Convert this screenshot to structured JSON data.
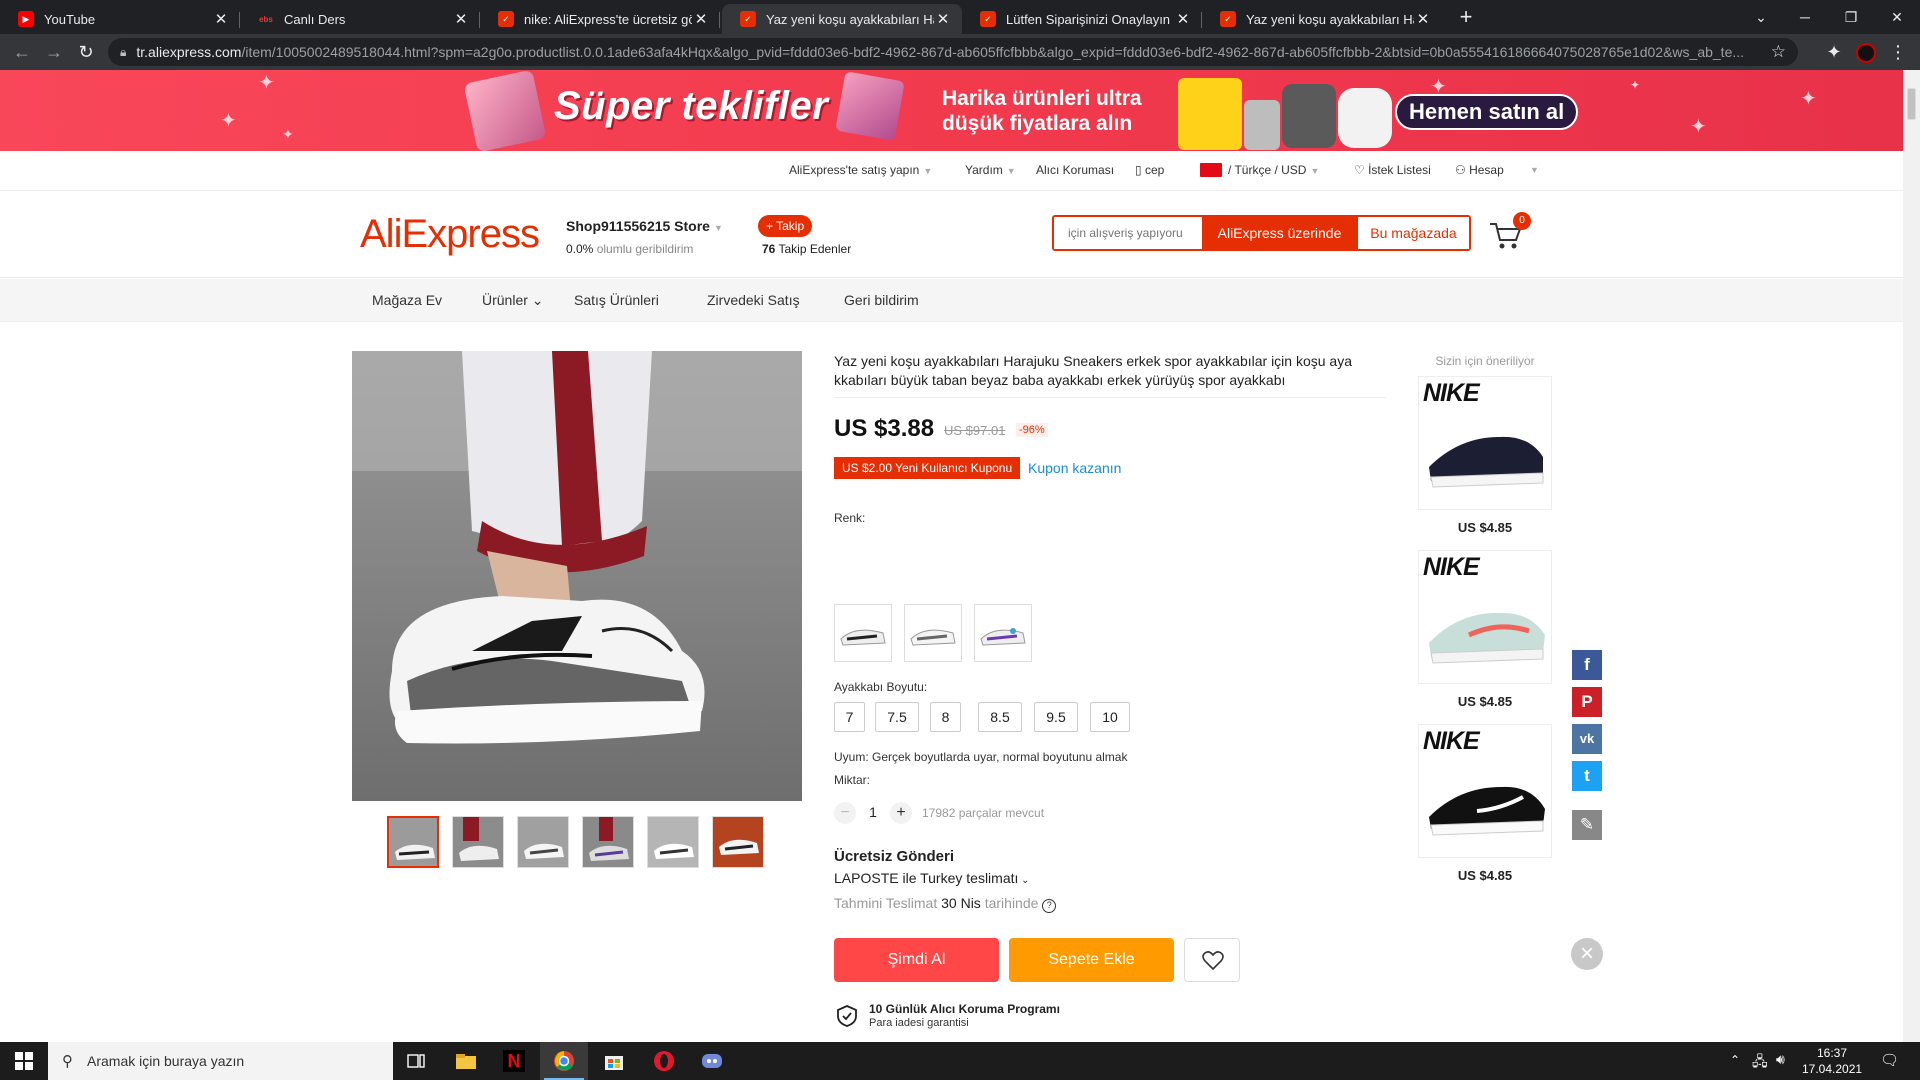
{
  "browser": {
    "tabs": [
      {
        "title": "YouTube",
        "favicon": "youtube-icon",
        "color": "#ff0000"
      },
      {
        "title": "Canlı Ders",
        "favicon": "ebs-icon",
        "color": "#e43a3a"
      },
      {
        "title": "nike: AliExpress'te ücretsiz gönde",
        "favicon": "aliexpress-icon",
        "color": "#e62e04"
      },
      {
        "title": "Yaz yeni koşu ayakkabıları Harajuk",
        "favicon": "aliexpress-icon",
        "color": "#e62e04",
        "active": true
      },
      {
        "title": "Lütfen Siparişinizi Onaylayın - Ali",
        "favicon": "aliexpress-icon",
        "color": "#e62e04"
      },
      {
        "title": "Yaz yeni koşu ayakkabıları Harajuk",
        "favicon": "aliexpress-icon",
        "color": "#e62e04"
      }
    ],
    "new_tab": "+",
    "url_host": "tr.aliexpress.com",
    "url_path": "/item/1005002489518044.html?spm=a2g0o.productlist.0.0.1ade63afa4kHqx&algo_pvid=fddd03e6-bdf2-4962-867d-ab605ffcfbbb&algo_expid=fddd03e6-bdf2-4962-867d-ab605ffcfbbb-2&btsid=0b0a555416186664075028765e1d02&ws_ab_te..."
  },
  "promo": {
    "title": "Süper teklifler",
    "line1": "Harika ürünleri ultra",
    "line2": "düşük fiyatlara alın",
    "cta": "Hemen satın al"
  },
  "util_bar": {
    "sell": "AliExpress'te satış yapın",
    "help": "Yardım",
    "buyer_protection": "Alıcı Koruması",
    "mobile": "cep",
    "language": "/ Türkçe / USD",
    "wishlist": "İstek Listesi",
    "account": "Hesap"
  },
  "store": {
    "logo": "AliExpress",
    "name": "Shop911556215 Store",
    "feedback_value": "0.0%",
    "feedback_text": "olumlu geribildirim",
    "follow": "+ Takip",
    "followers_count": "76",
    "followers_label": "Takip Edenler",
    "search_placeholder": "için alışveriş yapıyoru",
    "search_all": "AliExpress üzerinde",
    "search_store": "Bu mağazada",
    "cart_count": "0"
  },
  "store_nav": [
    "Mağaza Ev",
    "Ürünler",
    "Satış Ürünleri",
    "Zirvedeki Satış",
    "Geri bildirim"
  ],
  "product": {
    "title": "Yaz yeni koşu ayakkabıları Harajuku Sneakers erkek spor ayakkabılar için koşu aya kkabıları büyük taban beyaz baba ayakkabı erkek yürüyüş spor ayakkabı",
    "price": "US $3.88",
    "old_price": "US $97.01",
    "discount": "-96%",
    "coupon": "US $2.00 Yeni Kullanıcı Kuponu",
    "coupon_link": "Kupon kazanın",
    "color_label": "Renk:",
    "size_label": "Ayakkabı Boyutu:",
    "sizes": [
      "7",
      "7.5",
      "8",
      "8.5",
      "9.5",
      "10"
    ],
    "fit": "Uyum: Gerçek boyutlarda uyar, normal boyutunu almak",
    "qty_label": "Miktar:",
    "qty": "1",
    "qty_minus": "−",
    "qty_plus": "+",
    "available": "17982 parçalar mevcut",
    "shipping_title": "Ücretsiz Gönderi",
    "shipping_via": "LAPOSTE ile Turkey teslimatı",
    "delivery_prefix": "Tahmini Teslimat",
    "delivery_date": "30 Nis",
    "delivery_suffix": "tarihinde",
    "buy_now": "Şimdi Al",
    "add_to_cart": "Sepete Ekle",
    "protection_title": "10 Günlük Alıcı Koruma Programı",
    "protection_sub": "Para iadesi garantisi"
  },
  "recommend": {
    "title": "Sizin için öneriliyor",
    "brand": "NIKE",
    "items": [
      {
        "price": "US $4.85"
      },
      {
        "price": "US $4.85"
      },
      {
        "price": "US $4.85"
      }
    ]
  },
  "share": [
    {
      "icon": "facebook-icon",
      "glyph": "f",
      "color": "#3b5998"
    },
    {
      "icon": "pinterest-icon",
      "glyph": "P",
      "color": "#cb2027"
    },
    {
      "icon": "vk-icon",
      "glyph": "vk",
      "color": "#4c75a3"
    },
    {
      "icon": "twitter-icon",
      "glyph": "t",
      "color": "#1da1f2"
    },
    {
      "icon": "edit-icon",
      "glyph": "✎",
      "color": "#888888"
    }
  ],
  "taskbar": {
    "search_placeholder": "Aramak için buraya yazın",
    "time": "16:37",
    "date": "17.04.2021"
  }
}
